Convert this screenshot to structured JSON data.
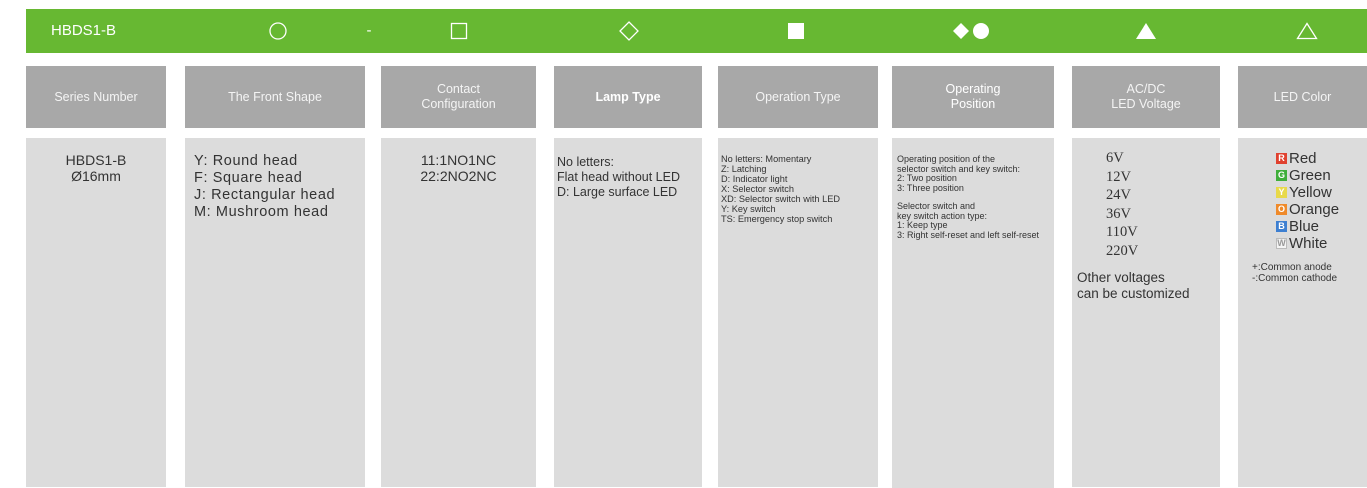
{
  "topbar": {
    "series_code": "HBDS1-B",
    "separator": "-",
    "symbols": [
      "circle-outline-icon",
      "square-outline-icon",
      "diamond-outline-icon",
      "square-filled-icon",
      "diamond-circle-filled-icon",
      "triangle-filled-icon",
      "triangle-outline-icon"
    ]
  },
  "columns": [
    {
      "header": [
        "Series Number"
      ],
      "lines": [
        "HBDS1-B",
        "Ø16mm"
      ]
    },
    {
      "header": [
        "The Front Shape"
      ],
      "lines": [
        "Y:  Round head",
        "F:  Square head",
        "J:  Rectangular head",
        "M:  Mushroom head"
      ]
    },
    {
      "header": [
        "Contact",
        "Configuration"
      ],
      "lines": [
        "11:1NO1NC",
        "22:2NO2NC"
      ]
    },
    {
      "header": [
        "Lamp Type"
      ],
      "lines": [
        "No letters:",
        "Flat head without LED",
        "D: Large surface LED"
      ]
    },
    {
      "header": [
        "Operation Type"
      ],
      "lines": [
        "No letters:  Momentary",
        "Z:  Latching",
        "D:  Indicator light",
        "X:  Selector switch",
        "XD:  Selector switch with LED",
        "Y:  Key switch",
        "TS:  Emergency stop switch"
      ]
    },
    {
      "header": [
        "Operating",
        "Position"
      ],
      "lines_a": [
        "Operating position of the",
        "selector switch and key switch:",
        "2:  Two position",
        "3:  Three position"
      ],
      "lines_b": [
        "Selector switch and",
        "key switch action type:",
        "1:  Keep type",
        "3:  Right self-reset and left self-reset"
      ]
    },
    {
      "header": [
        "AC/DC",
        "LED Voltage"
      ],
      "voltages": [
        "6V",
        "12V",
        "24V",
        "36V",
        "110V",
        "220V"
      ],
      "other": [
        "Other voltages",
        "can be customized"
      ]
    },
    {
      "header": [
        "LED Color"
      ],
      "colors": [
        {
          "letter": "R",
          "name": "Red",
          "hex": "#e0412f"
        },
        {
          "letter": "G",
          "name": "Green",
          "hex": "#3fae3a"
        },
        {
          "letter": "Y",
          "name": "Yellow",
          "hex": "#e8d94a"
        },
        {
          "letter": "O",
          "name": "Orange",
          "hex": "#ef8a2a"
        },
        {
          "letter": "B",
          "name": "Blue",
          "hex": "#3d7fd1"
        },
        {
          "letter": "W",
          "name": "White",
          "hex": "#f4f4f4"
        }
      ],
      "notes": [
        "+:Common anode",
        "-:Common cathode"
      ]
    }
  ]
}
